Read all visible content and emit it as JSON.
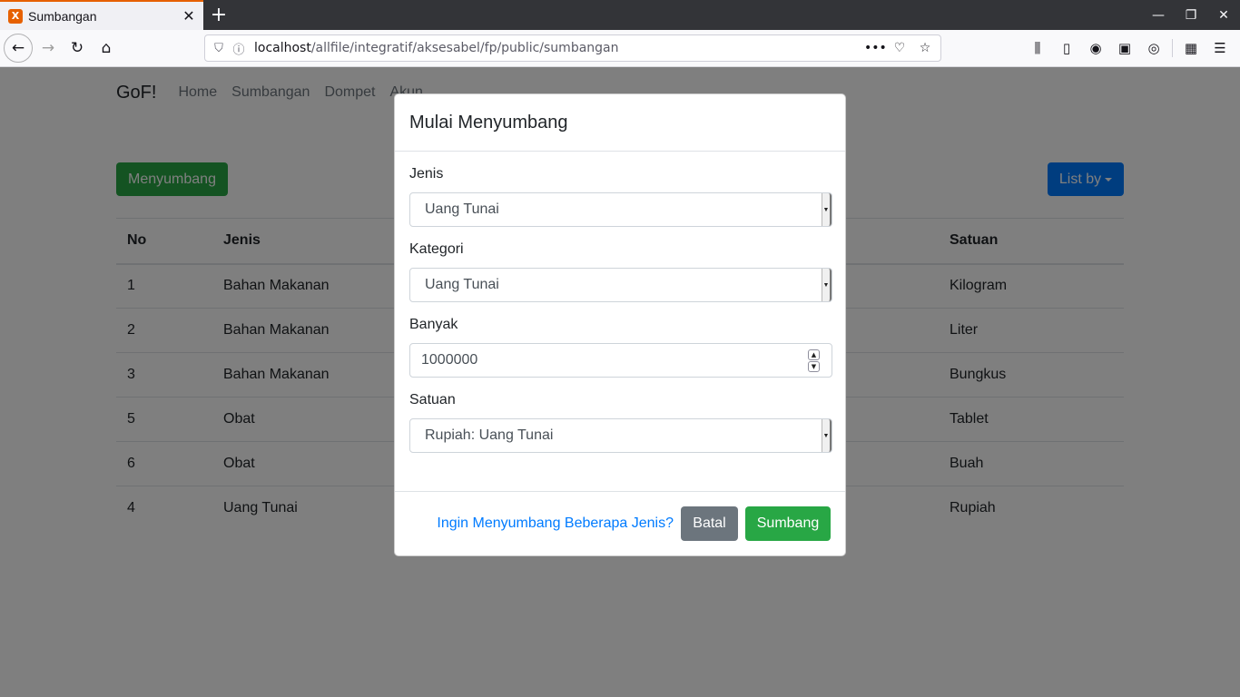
{
  "browser": {
    "tab_title": "Sumbangan",
    "favicon_label": "X",
    "url_host": "localhost",
    "url_path": "/allfile/integratif/aksesabel/fp/public/sumbangan"
  },
  "site": {
    "brand": "GoF!",
    "nav": [
      "Home",
      "Sumbangan",
      "Dompet",
      "Akun"
    ]
  },
  "toolbar": {
    "donate_label": "Menyumbang",
    "listby_label": "List by"
  },
  "table": {
    "headers": {
      "no": "No",
      "jenis": "Jenis",
      "satuan": "Satuan"
    },
    "rows": [
      {
        "no": "1",
        "jenis": "Bahan Makanan",
        "satuan": "Kilogram"
      },
      {
        "no": "2",
        "jenis": "Bahan Makanan",
        "satuan": "Liter"
      },
      {
        "no": "3",
        "jenis": "Bahan Makanan",
        "satuan": "Bungkus"
      },
      {
        "no": "5",
        "jenis": "Obat",
        "satuan": "Tablet"
      },
      {
        "no": "6",
        "jenis": "Obat",
        "satuan": "Buah"
      },
      {
        "no": "4",
        "jenis": "Uang Tunai",
        "satuan": "Rupiah"
      }
    ]
  },
  "modal": {
    "title": "Mulai Menyumbang",
    "fields": {
      "jenis": {
        "label": "Jenis",
        "value": "Uang Tunai"
      },
      "kategori": {
        "label": "Kategori",
        "value": "Uang Tunai"
      },
      "banyak": {
        "label": "Banyak",
        "value": "1000000"
      },
      "satuan": {
        "label": "Satuan",
        "value": "Rupiah: Uang Tunai"
      }
    },
    "link_multi": "Ingin Menyumbang Beberapa Jenis?",
    "cancel_label": "Batal",
    "submit_label": "Sumbang"
  },
  "colors": {
    "success": "#28a745",
    "primary": "#007bff",
    "secondary": "#6c757d",
    "tab_accent": "#e66000"
  }
}
